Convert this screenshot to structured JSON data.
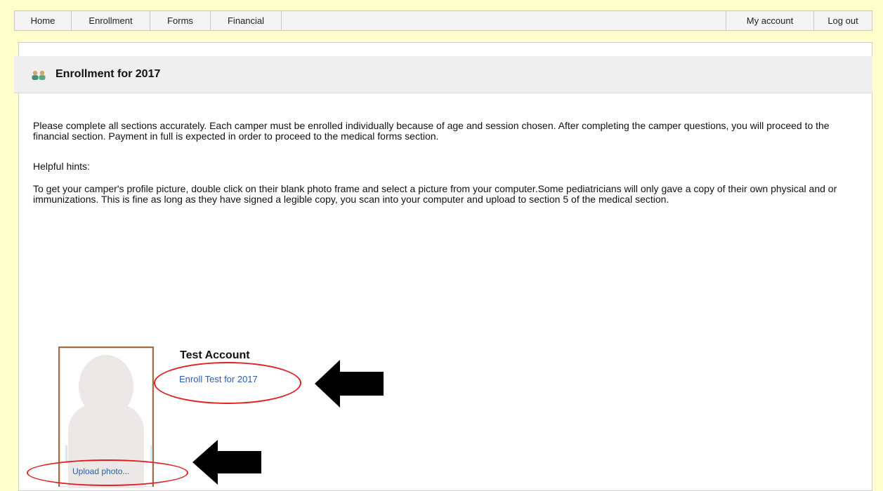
{
  "nav": {
    "left": [
      "Home",
      "Enrollment",
      "Forms",
      "Financial"
    ],
    "right": [
      "My account",
      "Log out"
    ]
  },
  "page": {
    "title": "Enrollment for 2017",
    "intro": "Please complete all sections accurately. Each camper must be enrolled individually because of age and session chosen. After completing the camper questions, you will proceed to the financial section. Payment in full is expected in order to proceed to the medical forms section.",
    "hints_label": "Helpful hints:",
    "hints_text": "To get your camper's profile picture, double click on their blank photo frame and select a picture from your computer.Some pediatricians will only gave a copy of their own physical and or immunizations. This is fine as long as they have signed a legible copy, you scan into your computer and upload to section 5 of the medical section."
  },
  "camper": {
    "name": "Test Account",
    "enroll_link": "Enroll Test for 2017",
    "upload_link": "Upload photo..."
  },
  "colors": {
    "page_background": "#ffffcc",
    "annotation_circle": "#e02020",
    "link": "#2a5db0"
  },
  "icons": {
    "title_icon": "people-icon",
    "annotation": "arrow-left-icon"
  }
}
